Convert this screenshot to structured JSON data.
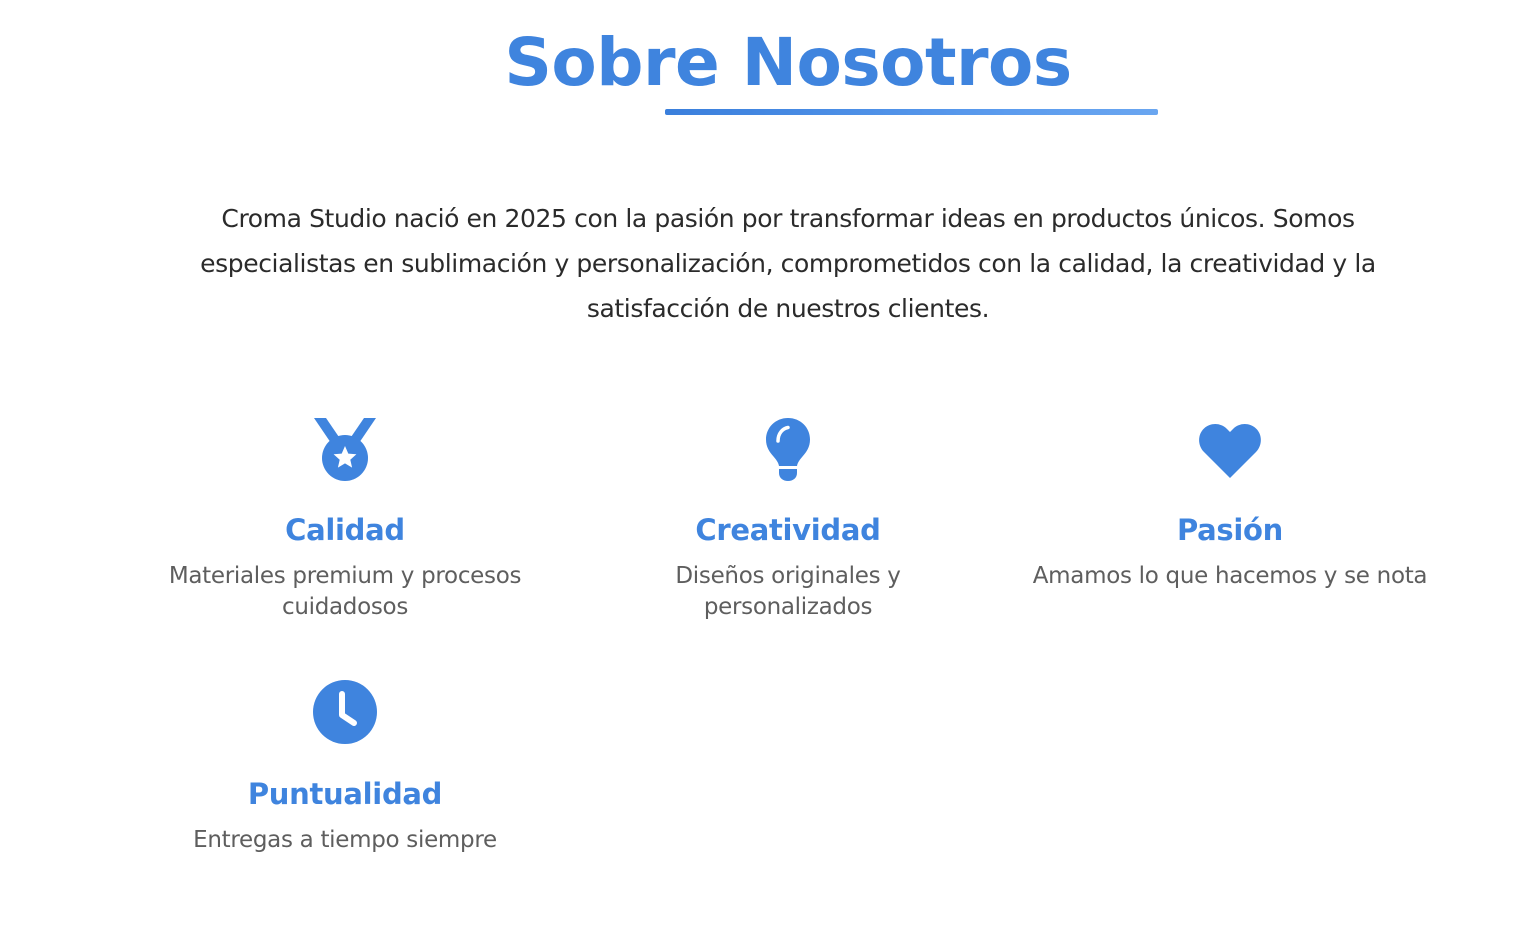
{
  "about": {
    "title": "Sobre Nosotros",
    "intro": "Croma Studio nació en 2025 con la pasión por transformar ideas en productos únicos. Somos especialistas en sublimación y personalización, comprometidos con la calidad, la creatividad y la satisfacción de nuestros clientes.",
    "accent_color": "#3f84de",
    "features": [
      {
        "icon": "medal-icon",
        "title": "Calidad",
        "description": "Materiales premium y procesos cuidadosos"
      },
      {
        "icon": "lightbulb-icon",
        "title": "Creatividad",
        "description": "Diseños originales y personalizados"
      },
      {
        "icon": "heart-icon",
        "title": "Pasión",
        "description": "Amamos lo que hacemos y se nota"
      },
      {
        "icon": "clock-icon",
        "title": "Puntualidad",
        "description": "Entregas a tiempo siempre"
      }
    ]
  }
}
